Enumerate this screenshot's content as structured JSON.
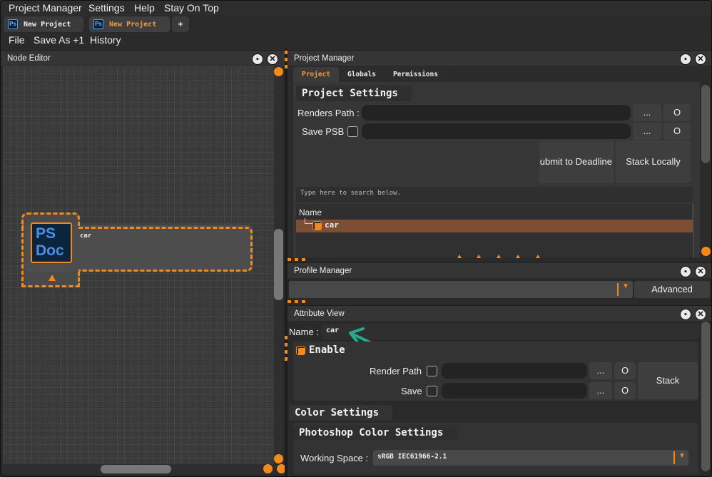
{
  "menubar": {
    "items": [
      "Project Manager",
      "Settings",
      "Help",
      "Stay On Top"
    ]
  },
  "tabs": [
    {
      "label": "New Project",
      "icon": "photoshop-icon",
      "icon_text": "Ps"
    },
    {
      "label": "New Project",
      "icon": "photoshop-icon",
      "icon_text": "Ps"
    }
  ],
  "add_tab_label": "+",
  "toolbar": {
    "items": [
      "File",
      "Save As +1",
      "History"
    ]
  },
  "node_editor": {
    "title": "Node Editor",
    "node": {
      "icon_line1": "PS",
      "icon_line2": "Doc",
      "name": "car"
    }
  },
  "project_manager": {
    "title": "Project Manager",
    "tabs": [
      "Project",
      "Globals",
      "Permissions"
    ],
    "section": "Project Settings",
    "renders_path_label": "Renders Path :",
    "renders_path_value": "",
    "save_psb_label": "Save PSB",
    "save_psb_checked": false,
    "browse_label": "...",
    "open_label": "O",
    "submit_deadline_label": "Submit to Deadline",
    "stack_locally_label": "Stack Locally",
    "search_placeholder": "Type here to search below.",
    "tree_header": "Name",
    "tree_items": [
      {
        "name": "car",
        "checked": true
      }
    ]
  },
  "profile_manager": {
    "title": "Profile Manager",
    "selected": "",
    "advanced_label": "Advanced"
  },
  "attribute_view": {
    "title": "Attribute View",
    "name_label": "Name :",
    "name_value": "car",
    "enable_label": "Enable",
    "enable_checked": true,
    "render_path_label": "Render Path",
    "save_label": "Save",
    "browse_label": "...",
    "open_label": "O",
    "stack_label": "Stack",
    "color_settings_title": "Color Settings",
    "photoshop_color_title": "Photoshop Color Settings",
    "working_space_label": "Working Space :",
    "working_space_value": "sRGB IEC61966-2.1"
  },
  "colors": {
    "accent": "#f08a1e",
    "tab_active_text": "#f39c33",
    "arrow": "#2aa88f"
  }
}
